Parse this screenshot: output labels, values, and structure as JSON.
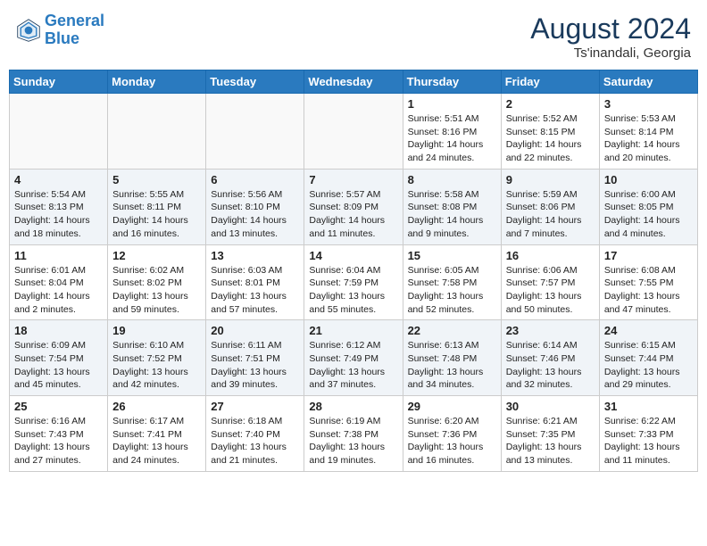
{
  "header": {
    "logo_line1": "General",
    "logo_line2": "Blue",
    "month_title": "August 2024",
    "location": "Ts'inandali, Georgia"
  },
  "weekdays": [
    "Sunday",
    "Monday",
    "Tuesday",
    "Wednesday",
    "Thursday",
    "Friday",
    "Saturday"
  ],
  "weeks": [
    [
      {
        "day": "",
        "info": ""
      },
      {
        "day": "",
        "info": ""
      },
      {
        "day": "",
        "info": ""
      },
      {
        "day": "",
        "info": ""
      },
      {
        "day": "1",
        "info": "Sunrise: 5:51 AM\nSunset: 8:16 PM\nDaylight: 14 hours\nand 24 minutes."
      },
      {
        "day": "2",
        "info": "Sunrise: 5:52 AM\nSunset: 8:15 PM\nDaylight: 14 hours\nand 22 minutes."
      },
      {
        "day": "3",
        "info": "Sunrise: 5:53 AM\nSunset: 8:14 PM\nDaylight: 14 hours\nand 20 minutes."
      }
    ],
    [
      {
        "day": "4",
        "info": "Sunrise: 5:54 AM\nSunset: 8:13 PM\nDaylight: 14 hours\nand 18 minutes."
      },
      {
        "day": "5",
        "info": "Sunrise: 5:55 AM\nSunset: 8:11 PM\nDaylight: 14 hours\nand 16 minutes."
      },
      {
        "day": "6",
        "info": "Sunrise: 5:56 AM\nSunset: 8:10 PM\nDaylight: 14 hours\nand 13 minutes."
      },
      {
        "day": "7",
        "info": "Sunrise: 5:57 AM\nSunset: 8:09 PM\nDaylight: 14 hours\nand 11 minutes."
      },
      {
        "day": "8",
        "info": "Sunrise: 5:58 AM\nSunset: 8:08 PM\nDaylight: 14 hours\nand 9 minutes."
      },
      {
        "day": "9",
        "info": "Sunrise: 5:59 AM\nSunset: 8:06 PM\nDaylight: 14 hours\nand 7 minutes."
      },
      {
        "day": "10",
        "info": "Sunrise: 6:00 AM\nSunset: 8:05 PM\nDaylight: 14 hours\nand 4 minutes."
      }
    ],
    [
      {
        "day": "11",
        "info": "Sunrise: 6:01 AM\nSunset: 8:04 PM\nDaylight: 14 hours\nand 2 minutes."
      },
      {
        "day": "12",
        "info": "Sunrise: 6:02 AM\nSunset: 8:02 PM\nDaylight: 13 hours\nand 59 minutes."
      },
      {
        "day": "13",
        "info": "Sunrise: 6:03 AM\nSunset: 8:01 PM\nDaylight: 13 hours\nand 57 minutes."
      },
      {
        "day": "14",
        "info": "Sunrise: 6:04 AM\nSunset: 7:59 PM\nDaylight: 13 hours\nand 55 minutes."
      },
      {
        "day": "15",
        "info": "Sunrise: 6:05 AM\nSunset: 7:58 PM\nDaylight: 13 hours\nand 52 minutes."
      },
      {
        "day": "16",
        "info": "Sunrise: 6:06 AM\nSunset: 7:57 PM\nDaylight: 13 hours\nand 50 minutes."
      },
      {
        "day": "17",
        "info": "Sunrise: 6:08 AM\nSunset: 7:55 PM\nDaylight: 13 hours\nand 47 minutes."
      }
    ],
    [
      {
        "day": "18",
        "info": "Sunrise: 6:09 AM\nSunset: 7:54 PM\nDaylight: 13 hours\nand 45 minutes."
      },
      {
        "day": "19",
        "info": "Sunrise: 6:10 AM\nSunset: 7:52 PM\nDaylight: 13 hours\nand 42 minutes."
      },
      {
        "day": "20",
        "info": "Sunrise: 6:11 AM\nSunset: 7:51 PM\nDaylight: 13 hours\nand 39 minutes."
      },
      {
        "day": "21",
        "info": "Sunrise: 6:12 AM\nSunset: 7:49 PM\nDaylight: 13 hours\nand 37 minutes."
      },
      {
        "day": "22",
        "info": "Sunrise: 6:13 AM\nSunset: 7:48 PM\nDaylight: 13 hours\nand 34 minutes."
      },
      {
        "day": "23",
        "info": "Sunrise: 6:14 AM\nSunset: 7:46 PM\nDaylight: 13 hours\nand 32 minutes."
      },
      {
        "day": "24",
        "info": "Sunrise: 6:15 AM\nSunset: 7:44 PM\nDaylight: 13 hours\nand 29 minutes."
      }
    ],
    [
      {
        "day": "25",
        "info": "Sunrise: 6:16 AM\nSunset: 7:43 PM\nDaylight: 13 hours\nand 27 minutes."
      },
      {
        "day": "26",
        "info": "Sunrise: 6:17 AM\nSunset: 7:41 PM\nDaylight: 13 hours\nand 24 minutes."
      },
      {
        "day": "27",
        "info": "Sunrise: 6:18 AM\nSunset: 7:40 PM\nDaylight: 13 hours\nand 21 minutes."
      },
      {
        "day": "28",
        "info": "Sunrise: 6:19 AM\nSunset: 7:38 PM\nDaylight: 13 hours\nand 19 minutes."
      },
      {
        "day": "29",
        "info": "Sunrise: 6:20 AM\nSunset: 7:36 PM\nDaylight: 13 hours\nand 16 minutes."
      },
      {
        "day": "30",
        "info": "Sunrise: 6:21 AM\nSunset: 7:35 PM\nDaylight: 13 hours\nand 13 minutes."
      },
      {
        "day": "31",
        "info": "Sunrise: 6:22 AM\nSunset: 7:33 PM\nDaylight: 13 hours\nand 11 minutes."
      }
    ]
  ]
}
